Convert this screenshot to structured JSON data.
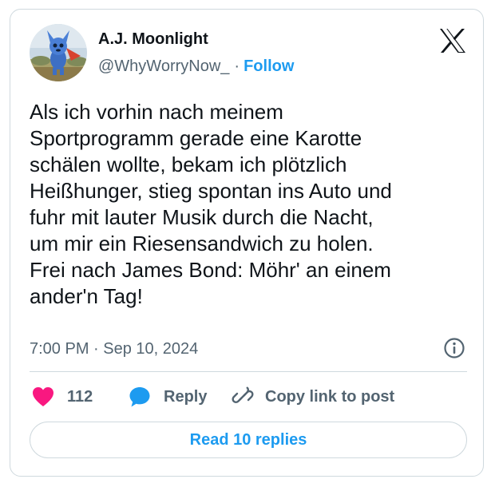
{
  "tweet": {
    "author_name": "A.J. Moonlight",
    "handle": "@WhyWorryNow_",
    "separator": "·",
    "follow_label": "Follow",
    "text": "Als ich vorhin nach meinem\nSportprogramm gerade eine Karotte\nschälen wollte, bekam ich plötzlich\nHeißhunger, stieg spontan ins Auto und\nfuhr mit lauter Musik durch die Nacht,\num mir ein Riesensandwich zu holen.\nFrei nach James Bond: Möhr' an einem\nander'n Tag!",
    "timestamp": "7:00 PM · Sep 10, 2024"
  },
  "actions": {
    "like_count": "112",
    "reply_label": "Reply",
    "copy_link_label": "Copy link to post"
  },
  "footer": {
    "read_replies_label": "Read 10 replies"
  },
  "icons": {
    "logo": "x-logo-icon",
    "info": "info-icon",
    "like": "heart-icon",
    "reply": "speech-bubble-icon",
    "copy": "link-icon"
  },
  "colors": {
    "accent": "#1d9bf0",
    "like": "#f91880",
    "text": "#0f1419",
    "secondary": "#536471",
    "border": "#cfd9de"
  }
}
